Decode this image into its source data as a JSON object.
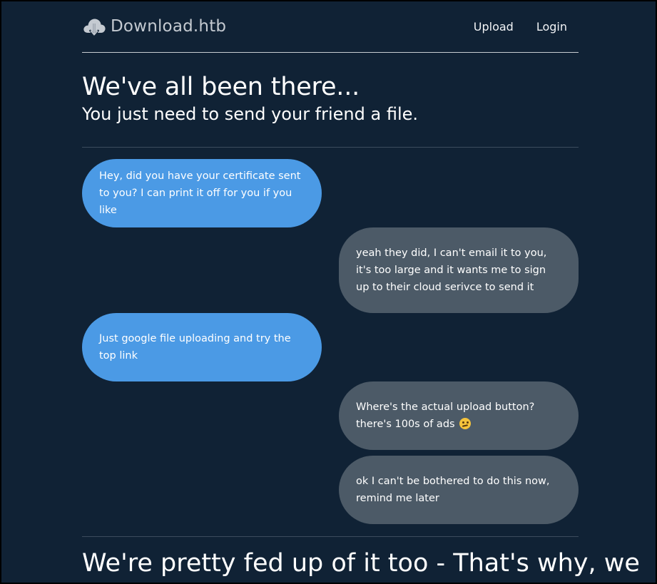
{
  "nav": {
    "brand": "Download.htb",
    "links": [
      "Upload",
      "Login"
    ]
  },
  "hero": {
    "title": "We've all been there...",
    "subtitle": "You just need to send your friend a file."
  },
  "chat": [
    {
      "side": "left",
      "text": "Hey, did you have your certificate sent to you? I can print it off for you if you like"
    },
    {
      "side": "right",
      "text": "yeah they did, I can't email it to you, it's too large and it wants me to sign up to their cloud serivce to send it"
    },
    {
      "side": "left",
      "text": "Just google file uploading and try the top link"
    },
    {
      "side": "right",
      "text": "Where's the actual upload button? there's 100s of ads",
      "emoji": "woozy-face-icon"
    },
    {
      "side": "right",
      "text": "ok I can't be bothered to do this now, remind me later"
    }
  ],
  "bottom": {
    "heading": "We're pretty fed up of it too - That's why, we"
  },
  "colors": {
    "background": "#102235",
    "left_bubble": "#4b9ae5",
    "right_bubble": "#4c5a67"
  }
}
